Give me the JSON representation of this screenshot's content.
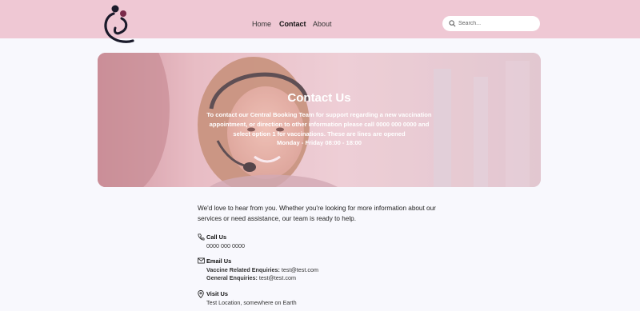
{
  "header": {
    "nav": [
      {
        "label": "Home",
        "active": false
      },
      {
        "label": "Contact",
        "active": true
      },
      {
        "label": "About",
        "active": false
      }
    ],
    "search": {
      "placeholder": "Search..."
    }
  },
  "hero": {
    "title": "Contact Us",
    "lines": [
      "To contact our Central Booking Team for support regarding a new vaccination",
      "appointment, or direction to other information please call 0000 000 0000 and",
      "select option 1 for vaccinations. These are lines are opened",
      "Monday - Friday 08:00 - 18:00"
    ]
  },
  "content": {
    "intro": "We'd love to hear from you. Whether you're looking for more information about our services or need assistance, our team is ready to help.",
    "call": {
      "title": "Call Us",
      "number": "0000 000 0000"
    },
    "email": {
      "title": "Email Us",
      "vaccine_label": "Vaccine Related Enquiries:",
      "vaccine_email": "test@test.com",
      "general_label": "General Enquiries:",
      "general_email": "test@test.com"
    },
    "visit": {
      "title": "Visit Us",
      "location": "Test Location, somewhere on Earth"
    }
  },
  "colors": {
    "header_bg": "#efc8d4",
    "page_bg": "#f8f8fd",
    "hero_tint": "#ebafc3"
  }
}
